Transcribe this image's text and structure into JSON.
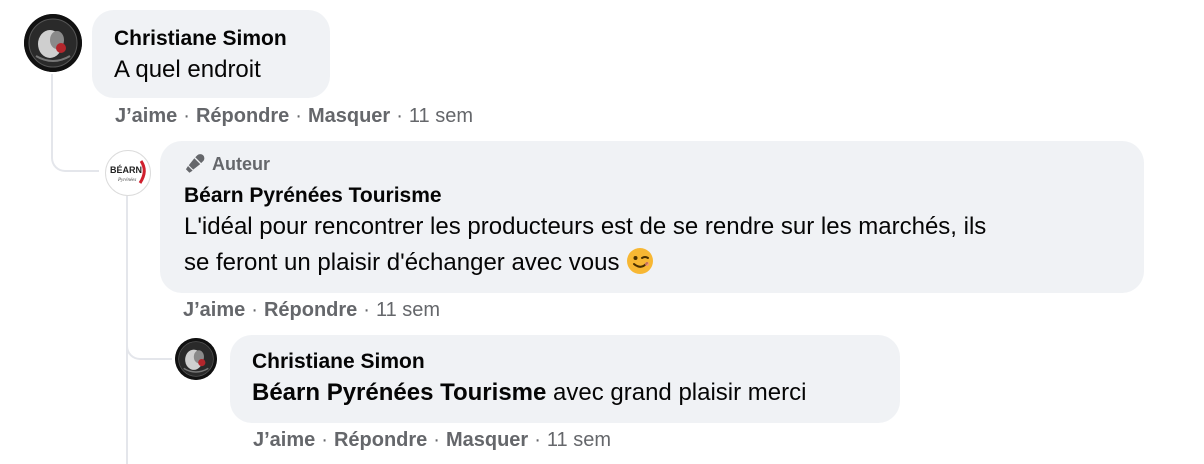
{
  "comments": [
    {
      "author": "Christiane Simon",
      "text": "A quel endroit",
      "actions": {
        "like": "J’aime",
        "reply": "Répondre",
        "hide": "Masquer"
      },
      "time": "11 sem"
    },
    {
      "badge": "Auteur",
      "author": "Béarn Pyrénées Tourisme",
      "avatar_text": "BÉARN",
      "avatar_subtext": "Pyrénées",
      "text_line1": "L'idéal pour rencontrer les producteurs est de se rendre sur les marchés, ils",
      "text_line2": "se feront un plaisir d'échanger avec vous",
      "emoji": "winking-face-icon",
      "actions": {
        "like": "J’aime",
        "reply": "Répondre"
      },
      "time": "11 sem"
    },
    {
      "author": "Christiane Simon",
      "mention": "Béarn Pyrénées Tourisme",
      "text": " avec grand plaisir merci",
      "actions": {
        "like": "J’aime",
        "reply": "Répondre",
        "hide": "Masquer"
      },
      "time": "11 sem"
    }
  ],
  "separator": "·",
  "colors": {
    "bubble": "#f0f2f5",
    "meta": "#65676b",
    "text": "#050505",
    "line": "#e4e6eb"
  }
}
